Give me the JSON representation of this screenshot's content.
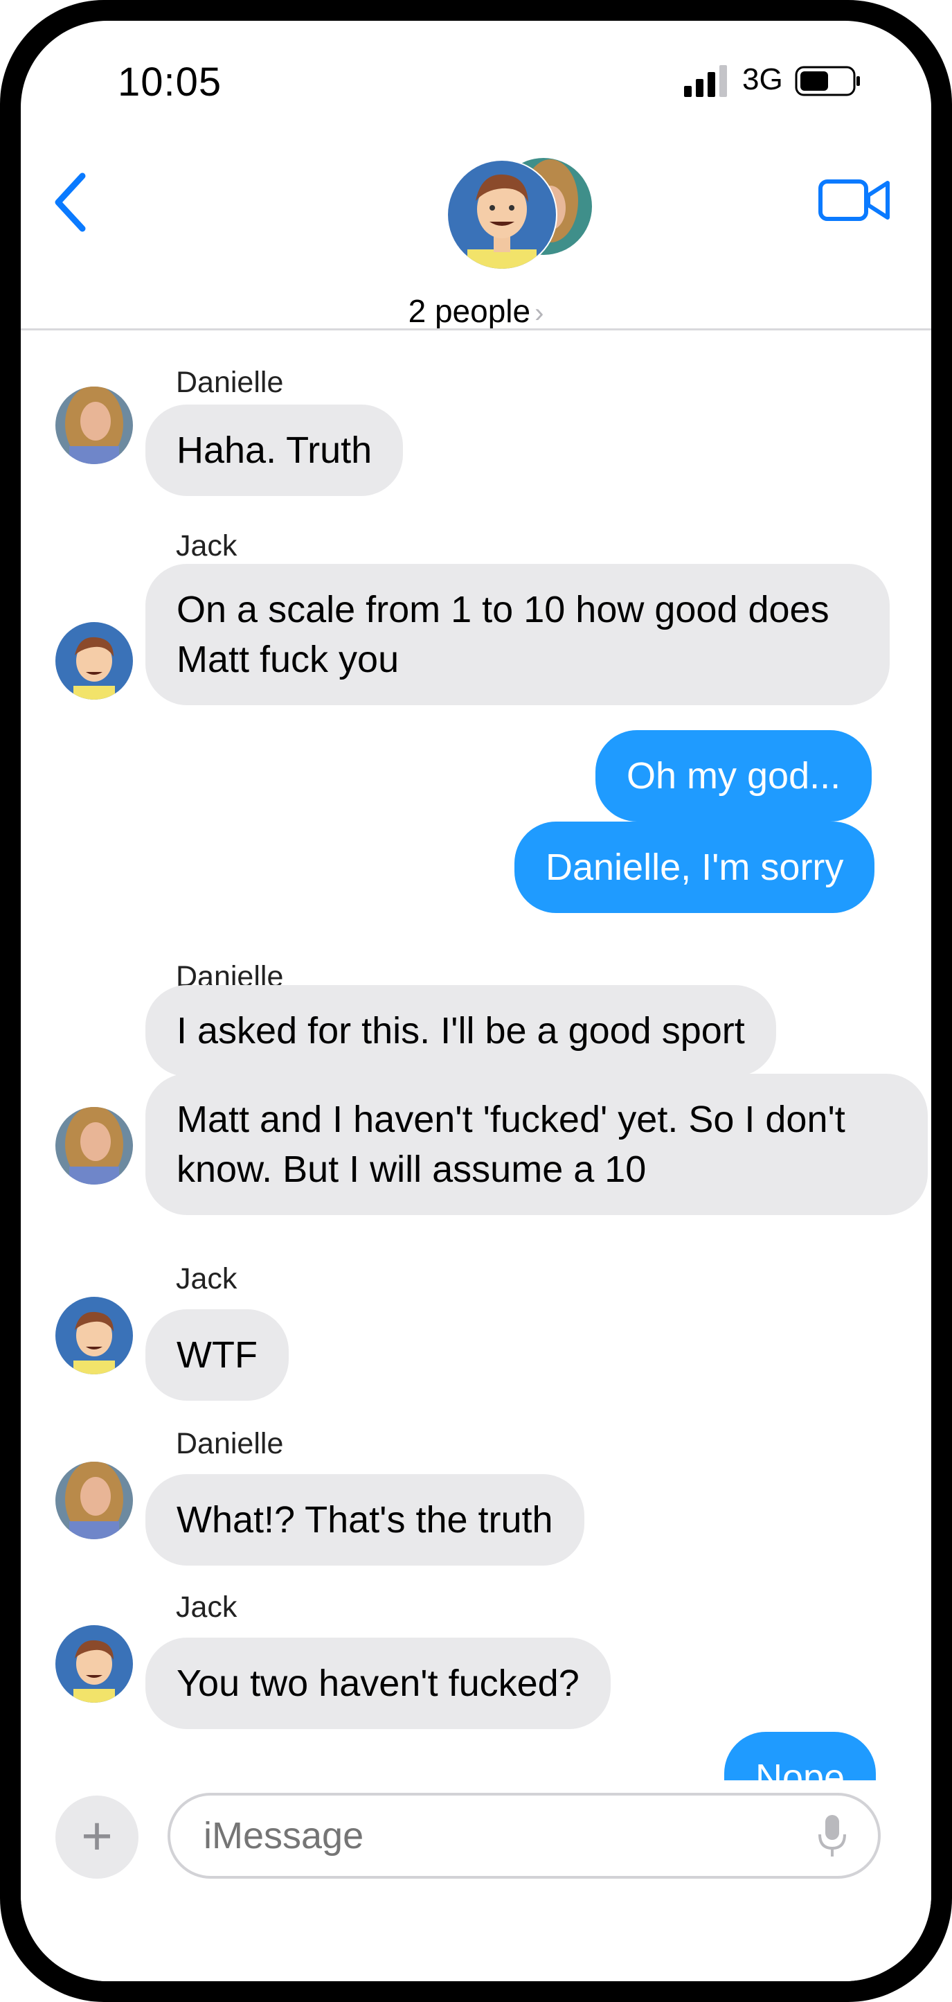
{
  "status": {
    "time": "10:05",
    "network": "3G"
  },
  "header": {
    "people_label": "2 people",
    "chevron": "›"
  },
  "messages": [
    {
      "sender": "Danielle",
      "text": "Haha.  Truth"
    },
    {
      "sender": "Jack",
      "text_line1": "On a scale from 1 to 10 how good does",
      "text_line2": "Matt fuck you"
    },
    {
      "sender": "me",
      "text": "Oh my god..."
    },
    {
      "sender": "me",
      "text": "Danielle, I'm sorry"
    },
    {
      "sender": "Danielle",
      "text": "I asked for this.  I'll be a good sport"
    },
    {
      "sender": "Danielle",
      "text_line1": "Matt and I haven't 'fucked' yet.  So I don't",
      "text_line2": "know.  But I will assume a 10"
    },
    {
      "sender": "Jack",
      "text": "WTF"
    },
    {
      "sender": "Danielle",
      "text": "What!?  That's the truth"
    },
    {
      "sender": "Jack",
      "text": "You two haven't fucked?"
    },
    {
      "sender": "me",
      "text": "Nope"
    }
  ],
  "input": {
    "placeholder": "iMessage",
    "plus": "+"
  },
  "icons": {
    "back": "chevron-left-icon",
    "video": "video-camera-icon",
    "mic": "microphone-icon",
    "signal": "cellular-signal-icon",
    "battery": "battery-icon"
  },
  "colors": {
    "accent": "#1f9bff",
    "incoming_bubble": "#e9e9eb",
    "ios_blue": "#0a7aff"
  }
}
